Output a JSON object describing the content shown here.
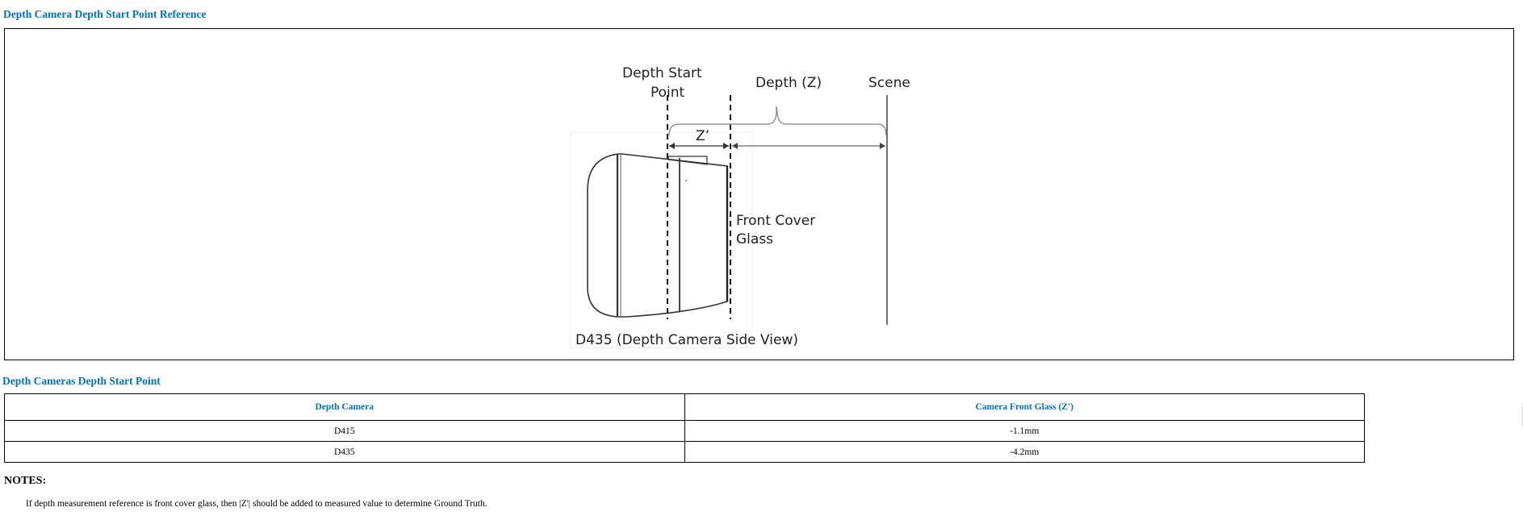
{
  "figure": {
    "title": "Depth Camera Depth Start Point Reference",
    "labels": {
      "depth_start_line1": "Depth Start",
      "depth_start_line2": "Point",
      "depth_z": "Depth (Z)",
      "scene": "Scene",
      "z_prime": "Z’",
      "front_cover_line1": "Front Cover",
      "front_cover_line2": "Glass",
      "caption": "D435 (Depth Camera Side View)"
    }
  },
  "table": {
    "title": "Depth Cameras Depth Start Point",
    "headers": [
      "Depth Camera",
      "Camera Front Glass (Z')"
    ],
    "rows": [
      [
        "D415",
        "-1.1mm"
      ],
      [
        "D435",
        "-4.2mm"
      ]
    ]
  },
  "notes": {
    "title": "NOTES:",
    "text": "If depth measurement reference is front cover glass, then |Z'| should be added to measured value to determine Ground Truth."
  }
}
